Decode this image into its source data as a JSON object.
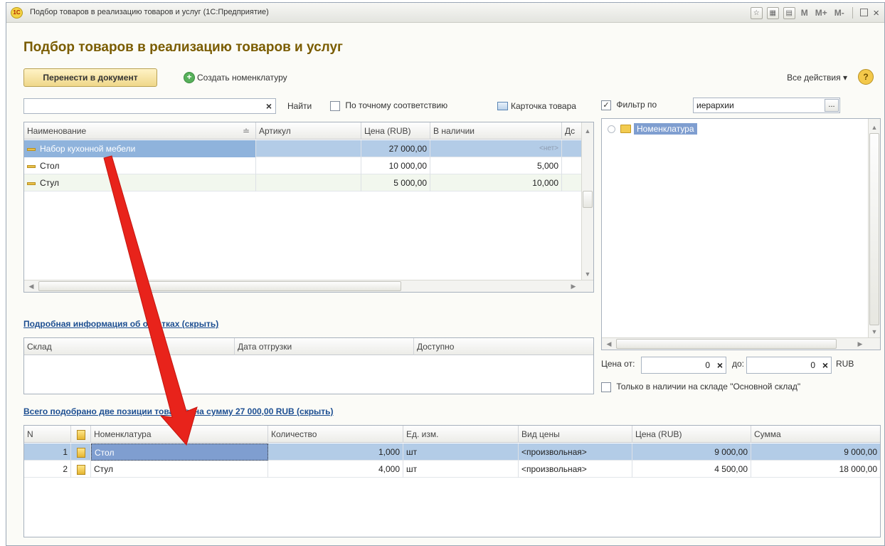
{
  "window": {
    "title": "Подбор товаров в реализацию товаров и услуг  (1С:Предприятие)",
    "logo": "1С",
    "tb_m": "M",
    "tb_mplus": "M+",
    "tb_mminus": "M-",
    "tb_maximize": "☐",
    "tb_close": "×"
  },
  "page": {
    "heading": "Подбор товаров в реализацию товаров и услуг",
    "transfer_button": "Перенести в документ",
    "create_nomenclature": "Создать номенклатуру",
    "all_actions": "Все действия",
    "help": "?"
  },
  "search": {
    "value": "",
    "find": "Найти",
    "exact_match": "По точному соответствию",
    "product_card": "Карточка товара"
  },
  "products": {
    "columns": [
      "Наименование",
      "Артикул",
      "Цена (RUB)",
      "В наличии",
      "Дс"
    ],
    "rows": [
      {
        "name": "Набор кухонной мебели",
        "article": "",
        "price": "27 000,00",
        "stock": "<нет>"
      },
      {
        "name": "Стол",
        "article": "",
        "price": "10 000,00",
        "stock": "5,000"
      },
      {
        "name": "Стул",
        "article": "",
        "price": "5 000,00",
        "stock": "10,000"
      }
    ]
  },
  "stock_info": {
    "link": "Подробная информация об остатках (скрыть)",
    "columns": [
      "Склад",
      "Дата отгрузки",
      "Доступно"
    ]
  },
  "filter": {
    "checked": true,
    "label": "Фильтр по",
    "value": "иерархии",
    "tree_root": "Номенклатура",
    "price_from_label": "Цена от:",
    "price_from": "0",
    "price_to_label": "до:",
    "price_to": "0",
    "currency": "RUB",
    "stock_only": "Только в наличии на складе \"Основной склад\""
  },
  "selected": {
    "summary": "Всего подобрано две позиции товаров, на сумму 27 000,00 RUB (скрыть)",
    "columns": [
      "N",
      "",
      "Номенклатура",
      "Количество",
      "Ед. изм.",
      "Вид цены",
      "Цена (RUB)",
      "Сумма"
    ],
    "rows": [
      {
        "n": "1",
        "name": "Стол",
        "qty": "1,000",
        "unit": "шт",
        "price_type": "<произвольная>",
        "price": "9 000,00",
        "sum": "9 000,00"
      },
      {
        "n": "2",
        "name": "Стул",
        "qty": "4,000",
        "unit": "шт",
        "price_type": "<произвольная>",
        "price": "4 500,00",
        "sum": "18 000,00"
      }
    ]
  },
  "colors": {
    "heading": "#7a5c00",
    "link": "#1c4e91",
    "selection": "#b3cce7",
    "annotation_arrow": "#e8231b"
  }
}
